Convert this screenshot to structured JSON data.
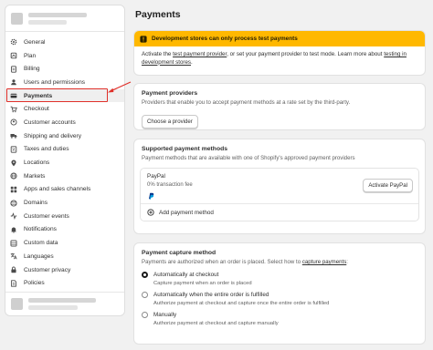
{
  "sidebar": {
    "items": [
      {
        "label": "General",
        "icon": "gear-icon"
      },
      {
        "label": "Plan",
        "icon": "plan-icon"
      },
      {
        "label": "Billing",
        "icon": "billing-icon"
      },
      {
        "label": "Users and permissions",
        "icon": "user-icon"
      },
      {
        "label": "Payments",
        "icon": "payments-icon"
      },
      {
        "label": "Checkout",
        "icon": "cart-icon"
      },
      {
        "label": "Customer accounts",
        "icon": "customer-icon"
      },
      {
        "label": "Shipping and delivery",
        "icon": "truck-icon"
      },
      {
        "label": "Taxes and duties",
        "icon": "tax-icon"
      },
      {
        "label": "Locations",
        "icon": "location-icon"
      },
      {
        "label": "Markets",
        "icon": "globe-icon"
      },
      {
        "label": "Apps and sales channels",
        "icon": "apps-icon"
      },
      {
        "label": "Domains",
        "icon": "domain-icon"
      },
      {
        "label": "Customer events",
        "icon": "events-icon"
      },
      {
        "label": "Notifications",
        "icon": "bell-icon"
      },
      {
        "label": "Custom data",
        "icon": "data-icon"
      },
      {
        "label": "Languages",
        "icon": "language-icon"
      },
      {
        "label": "Customer privacy",
        "icon": "lock-icon"
      },
      {
        "label": "Policies",
        "icon": "policy-icon"
      }
    ]
  },
  "page": {
    "title": "Payments"
  },
  "banner": {
    "heading": "Development stores can only process test payments",
    "text_1": "Activate the ",
    "link_1": "test payment provider",
    "text_2": ", or set your payment provider to test mode. Learn more about ",
    "link_2": "testing in development stores",
    "text_3": "."
  },
  "providers": {
    "title": "Payment providers",
    "subtitle": "Providers that enable you to accept payment methods at a rate set by the third-party.",
    "button": "Choose a provider"
  },
  "methods": {
    "title": "Supported payment methods",
    "subtitle": "Payment methods that are available with one of Shopify's approved payment providers",
    "paypal_name": "PayPal",
    "paypal_fee": "0% transaction fee",
    "paypal_button": "Activate PayPal",
    "add_label": "Add payment method"
  },
  "capture": {
    "title": "Payment capture method",
    "subtitle_1": "Payments are authorized when an order is placed. Select how to ",
    "subtitle_link": "capture payments",
    "subtitle_2": ":",
    "options": [
      {
        "label": "Automatically at checkout",
        "desc": "Capture payment when an order is placed",
        "checked": true
      },
      {
        "label": "Automatically when the entire order is fulfilled",
        "desc": "Authorize payment at checkout and capture once the entire order is fulfilled",
        "checked": false
      },
      {
        "label": "Manually",
        "desc": "Authorize payment at checkout and capture manually",
        "checked": false
      }
    ]
  },
  "colors": {
    "banner": "#ffb800",
    "highlight": "#e0302a",
    "paypal_dark": "#003087",
    "paypal_light": "#009cde"
  }
}
